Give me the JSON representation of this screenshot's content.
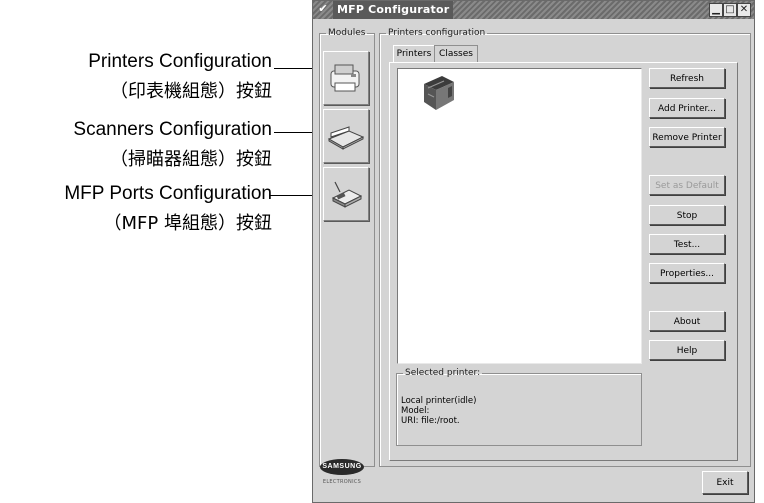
{
  "callouts": [
    {
      "label": "Printers Configuration",
      "sub": "（印表機組態）按鈕"
    },
    {
      "label": "Scanners Configuration",
      "sub": "（掃瞄器組態）按鈕"
    },
    {
      "label": "MFP Ports Configuration",
      "sub": "（MFP 埠組態）按鈕"
    }
  ],
  "window": {
    "title": "MFP Configurator",
    "menu_glyph": "✔",
    "minimize": "▁",
    "maximize": "□",
    "close": "✕"
  },
  "modules": {
    "legend": "Modules",
    "items": [
      {
        "icon": "printer-icon"
      },
      {
        "icon": "scanner-icon"
      },
      {
        "icon": "mfp-port-icon"
      }
    ],
    "logo": "SAMSUNG",
    "logo_sub": "ELECTRONICS"
  },
  "printers_configuration": {
    "legend": "Printers configuration",
    "tabs": [
      {
        "label": "Printers",
        "active": true
      },
      {
        "label": "Classes",
        "active": false
      }
    ],
    "selected_printer": {
      "legend": "Selected printer:",
      "lines": [
        "Local printer(idle)",
        "Model:",
        "URI: file:/root."
      ]
    },
    "buttons": [
      {
        "label": "Refresh",
        "enabled": true
      },
      {
        "label": "Add Printer...",
        "enabled": true
      },
      {
        "label": "Remove Printer",
        "enabled": true
      },
      {
        "label": "Set as Default",
        "enabled": false
      },
      {
        "label": "Stop",
        "enabled": true
      },
      {
        "label": "Test...",
        "enabled": true
      },
      {
        "label": "Properties...",
        "enabled": true
      },
      {
        "label": "About",
        "enabled": true
      },
      {
        "label": "Help",
        "enabled": true
      }
    ]
  },
  "exit_label": "Exit"
}
